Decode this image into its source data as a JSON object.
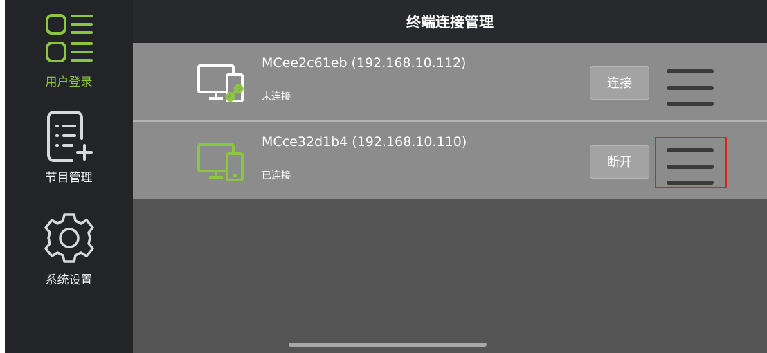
{
  "header": {
    "title": "终端连接管理"
  },
  "sidebar": {
    "items": [
      {
        "label": "用户登录",
        "icon": "user-login-grid-icon",
        "active": true
      },
      {
        "label": "节目管理",
        "icon": "program-list-add-icon",
        "active": false
      },
      {
        "label": "系统设置",
        "icon": "gear-icon",
        "active": false
      }
    ]
  },
  "devices": [
    {
      "name": "MCee2c61eb (192.168.10.112)",
      "status": "未连接",
      "action_label": "连接",
      "icon": "monitor-tablet-link-icon",
      "connected": false
    },
    {
      "name": "MCce32d1b4 (192.168.10.110)",
      "status": "已连接",
      "action_label": "断开",
      "icon": "monitor-tablet-icon",
      "connected": true
    }
  ],
  "colors": {
    "accent": "#8cc540",
    "highlight_box": "#e02020",
    "sidebar_bg": "#232428",
    "row_bg": "#8c8c8c",
    "content_bg": "#545454"
  }
}
